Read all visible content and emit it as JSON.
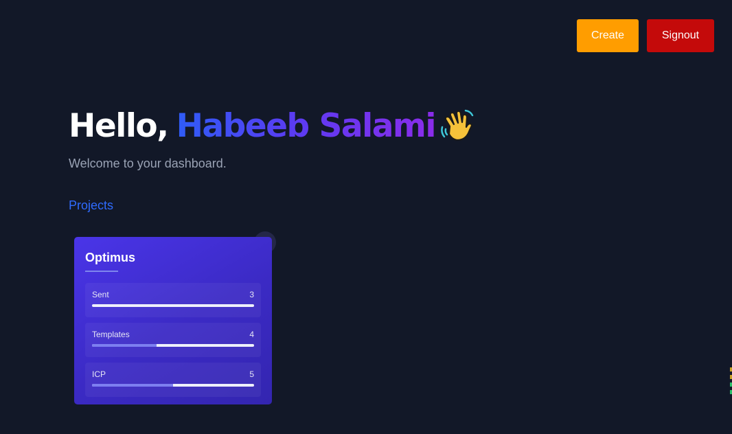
{
  "header": {
    "create_label": "Create",
    "signout_label": "Signout",
    "create_color": "#ff9d00",
    "signout_color": "#c40a0a"
  },
  "greeting": {
    "hello": "Hello,",
    "name": "Habeeb Salami",
    "emoji_icon": "waving-hand-icon",
    "subtitle": "Welcome to your dashboard."
  },
  "projects": {
    "section_label": "Projects",
    "items": [
      {
        "title": "Optimus",
        "stats": [
          {
            "label": "Sent",
            "value": "3",
            "fill": 0
          },
          {
            "label": "Templates",
            "value": "4",
            "fill": 0.4
          },
          {
            "label": "ICP",
            "value": "5",
            "fill": 0.5
          }
        ]
      }
    ]
  },
  "colors": {
    "background": "#121828",
    "accent_blue": "#2f6bff",
    "name_gradient_start": "#2f5cf6",
    "name_gradient_end": "#8b2cea"
  }
}
